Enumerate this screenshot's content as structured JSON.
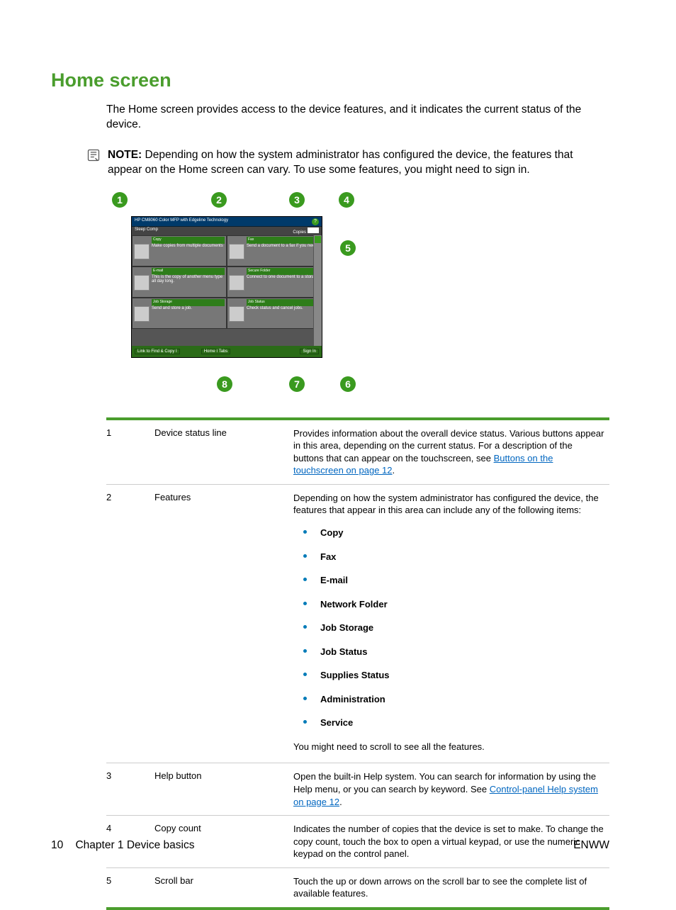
{
  "heading": "Home screen",
  "intro": "The Home screen provides access to the device features, and it indicates the current status of the device.",
  "note": {
    "label": "NOTE:",
    "text": "Depending on how the system administrator has configured the device, the features that appear on the Home screen can vary. To use some features, you might need to sign in."
  },
  "callouts": {
    "1": "1",
    "2": "2",
    "3": "3",
    "4": "4",
    "5": "5",
    "6": "6",
    "7": "7",
    "8": "8"
  },
  "screen": {
    "title": "HP CM8060 Color MFP with Edgeline Technology",
    "sub_left": "Sleep Comp",
    "sub_right": "Copies",
    "help": "?",
    "feats": {
      "copy_h": "Copy",
      "copy_t": "Make copies from multiple documents",
      "fax_h": "Fax",
      "fax_t": "Send a document to a fax if you need.",
      "email_h": "E-mail",
      "email_t": "This is the copy of another menu type all day long.",
      "nf_h": "Secure Folder",
      "nf_t": "Connect to one document to a storage",
      "js_h": "Job Storage",
      "js_t": "Send and store a job.",
      "st_h": "Job Status",
      "st_t": "Check status and cancel jobs."
    },
    "btn_left": "Link to Find & Copy I",
    "btn_mid": "Home I Tabs",
    "btn_right": "Sign In"
  },
  "table": [
    {
      "num": "1",
      "label": "Device status line",
      "desc": "Provides information about the overall device status. Various buttons appear in this area, depending on the current status. For a description of the buttons that can appear on the touchscreen, see ",
      "link": "Buttons on the touchscreen on page 12",
      "after": "."
    },
    {
      "num": "2",
      "label": "Features",
      "desc_top": "Depending on how the system administrator has configured the device, the features that appear in this area can include any of the following items:",
      "list": [
        "Copy",
        "Fax",
        "E-mail",
        "Network Folder",
        "Job Storage",
        "Job Status",
        "Supplies Status",
        "Administration",
        "Service"
      ],
      "desc_bottom": "You might need to scroll to see all the features."
    },
    {
      "num": "3",
      "label": "Help button",
      "desc": "Open the built-in Help system. You can search for information by using the Help menu, or you can search by keyword. See ",
      "link": "Control-panel Help system on page 12",
      "after": "."
    },
    {
      "num": "4",
      "label": "Copy count",
      "desc": "Indicates the number of copies that the device is set to make. To change the copy count, touch the box to open a virtual keypad, or use the numeric keypad on the control panel."
    },
    {
      "num": "5",
      "label": "Scroll bar",
      "desc": "Touch the up or down arrows on the scroll bar to see the complete list of available features."
    }
  ],
  "footer": {
    "page": "10",
    "chapter": "Chapter 1   Device basics",
    "brand": "ENWW"
  }
}
